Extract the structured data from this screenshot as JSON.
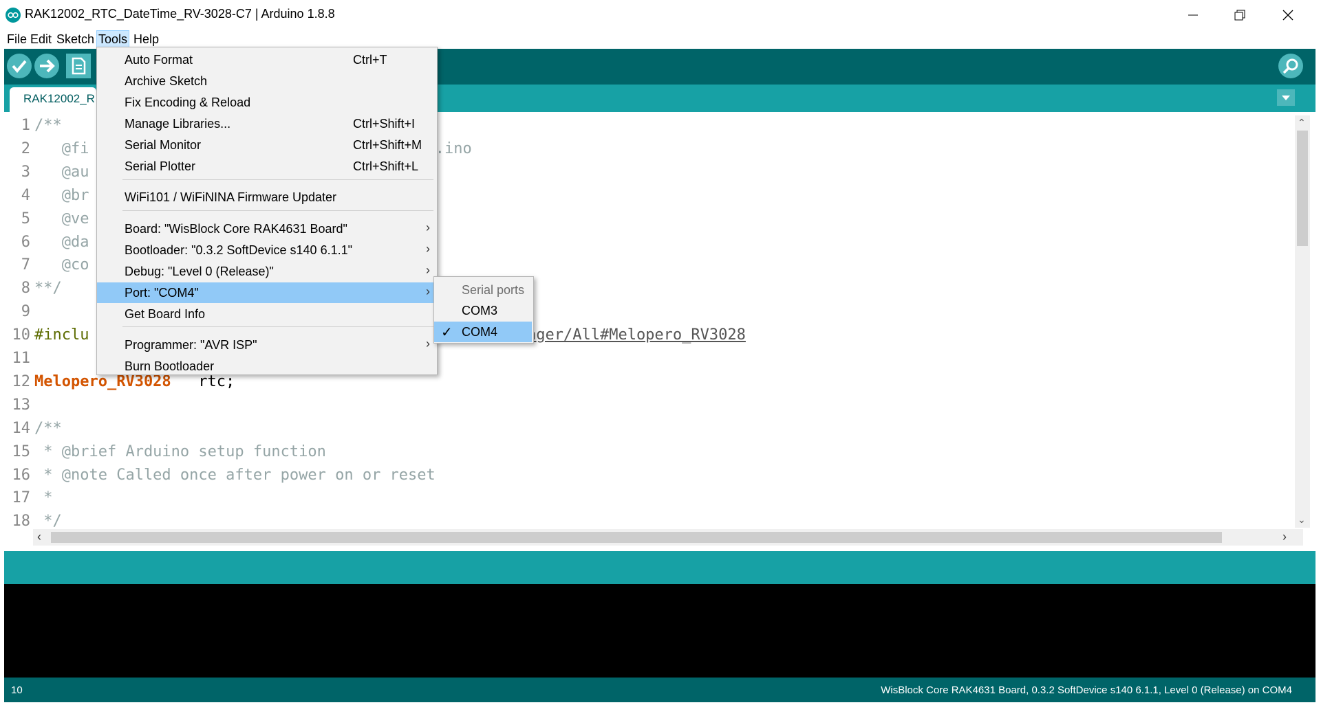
{
  "window": {
    "title": "RAK12002_RTC_DateTime_RV-3028-C7 | Arduino 1.8.8",
    "controls": {
      "minimize": "—",
      "maximize": "❐",
      "close": "✕"
    }
  },
  "menubar": {
    "file": "File",
    "edit": "Edit",
    "sketch": "Sketch",
    "tools": "Tools",
    "help": "Help"
  },
  "toolbar": {
    "verify_icon": "checkmark-icon",
    "upload_icon": "arrow-right-icon",
    "new_icon": "document-icon",
    "serial_monitor_icon": "magnifier-icon",
    "accent_dark": "#006468",
    "accent_light": "#17a1a5"
  },
  "tab": {
    "label": "RAK12002_R"
  },
  "editor": {
    "line_numbers": [
      "1",
      "2",
      "3",
      "4",
      "5",
      "6",
      "7",
      "8",
      "9",
      "10",
      "11",
      "12",
      "13",
      "14",
      "15",
      "16",
      "17",
      "18"
    ],
    "lines": [
      {
        "text": "/**",
        "color": "#95a5a6"
      },
      {
        "text": "   @fi                                    C7.ino",
        "color": "#95a5a6"
      },
      {
        "text": "   @au",
        "color": "#95a5a6"
      },
      {
        "text": "   @br",
        "color": "#95a5a6"
      },
      {
        "text": "   @ve",
        "color": "#95a5a6"
      },
      {
        "text": "   @da",
        "color": "#95a5a6"
      },
      {
        "text": "   @co",
        "color": "#95a5a6"
      },
      {
        "text": "**/",
        "color": "#95a5a6"
      },
      {
        "text": "",
        "color": "#95a5a6"
      },
      {
        "text": "#inclu",
        "color": "#5e6d03"
      },
      {
        "text": "",
        "color": "#95a5a6"
      },
      {
        "text": "Melopero_RV3028",
        "color": "#d35400"
      },
      {
        "text": "",
        "color": "#95a5a6"
      },
      {
        "text": "/**",
        "color": "#95a5a6"
      },
      {
        "text": " * @brief Arduino setup function",
        "color": "#95a5a6"
      },
      {
        "text": " * @note Called once after power on or reset",
        "color": "#95a5a6"
      },
      {
        "text": " *",
        "color": "#95a5a6"
      },
      {
        "text": " */",
        "color": "#95a5a6"
      }
    ],
    "line10_link": "ager/All#Melopero_RV3028",
    "line12_rest": " rtc;"
  },
  "tools_menu": {
    "items": [
      {
        "label": "Auto Format",
        "shortcut": "Ctrl+T"
      },
      {
        "label": "Archive Sketch",
        "shortcut": ""
      },
      {
        "label": "Fix Encoding & Reload",
        "shortcut": ""
      },
      {
        "label": "Manage Libraries...",
        "shortcut": "Ctrl+Shift+I"
      },
      {
        "label": "Serial Monitor",
        "shortcut": "Ctrl+Shift+M"
      },
      {
        "label": "Serial Plotter",
        "shortcut": "Ctrl+Shift+L"
      },
      {
        "label": "WiFi101 / WiFiNINA Firmware Updater",
        "shortcut": ""
      },
      {
        "label": "Board: \"WisBlock Core RAK4631 Board\"",
        "shortcut": "",
        "submenu": true
      },
      {
        "label": "Bootloader: \"0.3.2 SoftDevice s140 6.1.1\"",
        "shortcut": "",
        "submenu": true
      },
      {
        "label": "Debug: \"Level 0 (Release)\"",
        "shortcut": "",
        "submenu": true
      },
      {
        "label": "Port: \"COM4\"",
        "shortcut": "",
        "submenu": true,
        "highlighted": true
      },
      {
        "label": "Get Board Info",
        "shortcut": ""
      },
      {
        "label": "Programmer: \"AVR ISP\"",
        "shortcut": "",
        "submenu": true
      },
      {
        "label": "Burn Bootloader",
        "shortcut": ""
      }
    ],
    "submenu_arrow": "›"
  },
  "port_submenu": {
    "header": "Serial ports",
    "ports": [
      {
        "label": "COM3",
        "selected": false
      },
      {
        "label": "COM4",
        "selected": true
      }
    ],
    "check": "✓"
  },
  "statusbar": {
    "line": "10",
    "board_info": "WisBlock Core RAK4631 Board, 0.3.2 SoftDevice s140 6.1.1, Level 0 (Release) on COM4"
  }
}
